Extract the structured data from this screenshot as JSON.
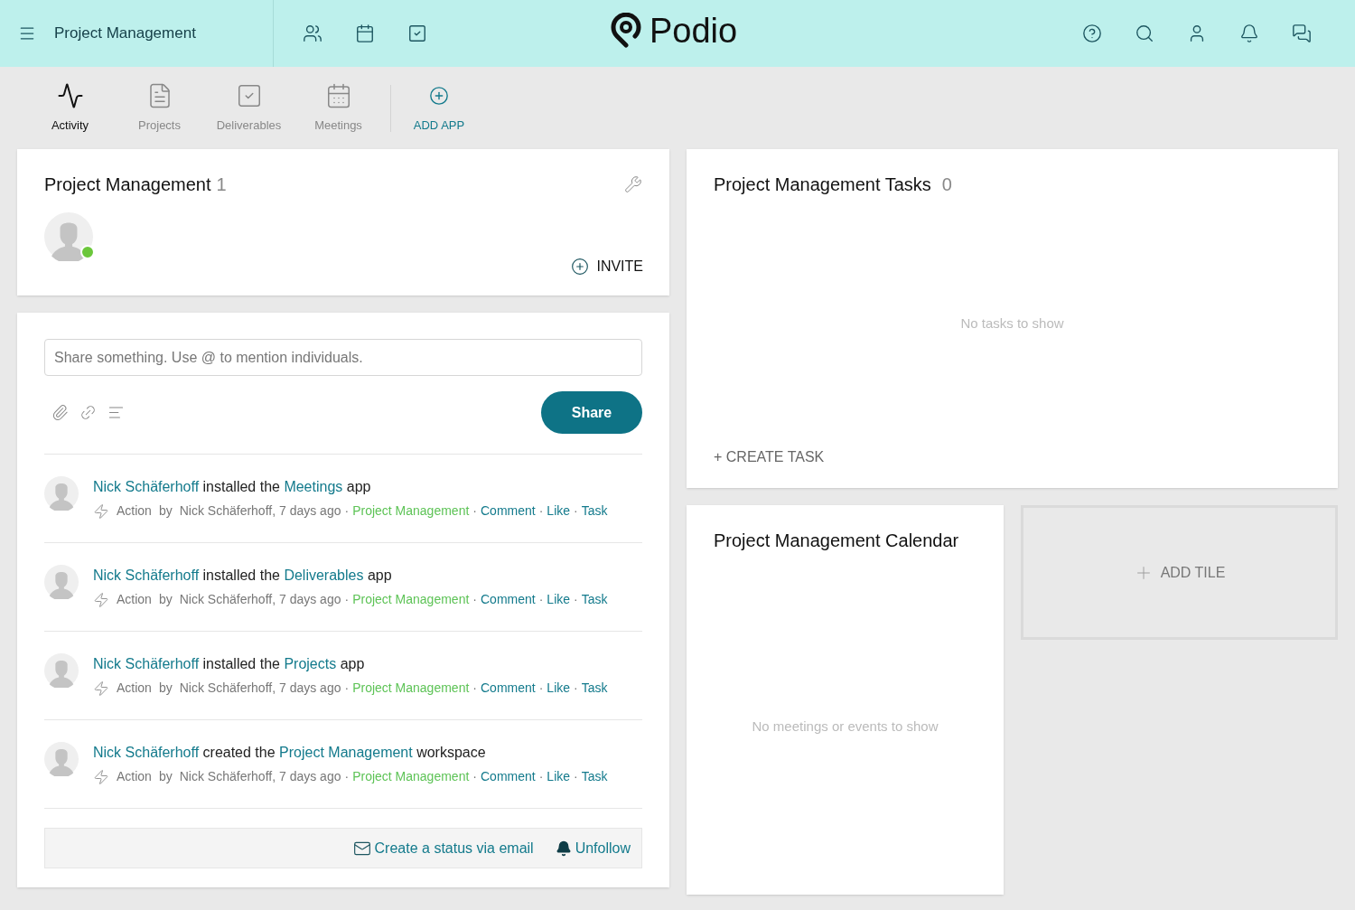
{
  "header": {
    "workspace": "Project Management",
    "logo": "Podio"
  },
  "apps": [
    {
      "label": "Activity",
      "selected": true
    },
    {
      "label": "Projects",
      "selected": false
    },
    {
      "label": "Deliverables",
      "selected": false
    },
    {
      "label": "Meetings",
      "selected": false
    }
  ],
  "add_app": "ADD APP",
  "members_card": {
    "title": "Project Management",
    "count": "1",
    "online": true,
    "invite": "INVITE"
  },
  "composer": {
    "placeholder": "Share something. Use @ to mention individuals.",
    "button": "Share"
  },
  "separator": "·",
  "activity": [
    {
      "actor": "Nick Schäferhoff",
      "verb": "installed the",
      "object": "Meetings",
      "suffix": "app",
      "action": "Action",
      "by": "by",
      "author": "Nick Schäferhoff, 7 days ago",
      "workspace": "Project Management",
      "links": [
        "Comment",
        "Like",
        "Task"
      ]
    },
    {
      "actor": "Nick Schäferhoff",
      "verb": "installed the",
      "object": "Deliverables",
      "suffix": "app",
      "action": "Action",
      "by": "by",
      "author": "Nick Schäferhoff, 7 days ago",
      "workspace": "Project Management",
      "links": [
        "Comment",
        "Like",
        "Task"
      ]
    },
    {
      "actor": "Nick Schäferhoff",
      "verb": "installed the",
      "object": "Projects",
      "suffix": "app",
      "action": "Action",
      "by": "by",
      "author": "Nick Schäferhoff, 7 days ago",
      "workspace": "Project Management",
      "links": [
        "Comment",
        "Like",
        "Task"
      ]
    },
    {
      "actor": "Nick Schäferhoff",
      "verb": "created the",
      "object": "Project Management",
      "suffix": "workspace",
      "action": "Action",
      "by": "by",
      "author": "Nick Schäferhoff, 7 days ago",
      "workspace": "Project Management",
      "links": [
        "Comment",
        "Like",
        "Task"
      ]
    }
  ],
  "footer": {
    "email": "Create a status via email",
    "unfollow": "Unfollow"
  },
  "tasks": {
    "title": "Project Management Tasks",
    "count": "0",
    "empty": "No tasks to show",
    "create": "+ CREATE TASK"
  },
  "calendar": {
    "title": "Project Management Calendar",
    "empty": "No meetings or events to show"
  },
  "add_tile": "ADD TILE"
}
